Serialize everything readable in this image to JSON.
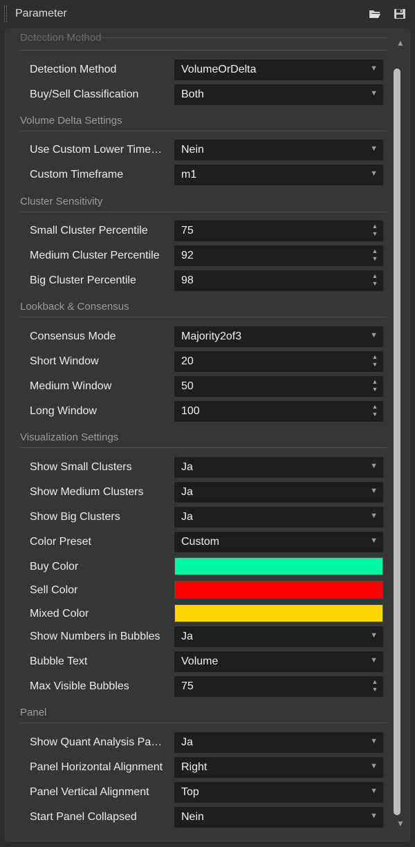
{
  "window": {
    "title": "Parameter"
  },
  "sections": {
    "detection": "Detection Method",
    "volume_delta": "Volume Delta Settings",
    "cluster": "Cluster Sensitivity",
    "lookback": "Lookback & Consensus",
    "visualization": "Visualization Settings",
    "panel": "Panel"
  },
  "rows": {
    "detection_method": {
      "label": "Detection Method",
      "value": "VolumeOrDelta"
    },
    "buy_sell_classification": {
      "label": "Buy/Sell Classification",
      "value": "Both"
    },
    "use_custom_lower_timeframe": {
      "label": "Use Custom Lower Time…",
      "value": "Nein"
    },
    "custom_timeframe": {
      "label": "Custom Timeframe",
      "value": "m1"
    },
    "small_cluster_percentile": {
      "label": "Small Cluster Percentile",
      "value": "75"
    },
    "medium_cluster_percentile": {
      "label": "Medium Cluster Percentile",
      "value": "92"
    },
    "big_cluster_percentile": {
      "label": "Big Cluster Percentile",
      "value": "98"
    },
    "consensus_mode": {
      "label": "Consensus Mode",
      "value": "Majority2of3"
    },
    "short_window": {
      "label": "Short Window",
      "value": "20"
    },
    "medium_window": {
      "label": "Medium Window",
      "value": "50"
    },
    "long_window": {
      "label": "Long Window",
      "value": "100"
    },
    "show_small_clusters": {
      "label": "Show Small Clusters",
      "value": "Ja"
    },
    "show_medium_clusters": {
      "label": "Show Medium Clusters",
      "value": "Ja"
    },
    "show_big_clusters": {
      "label": "Show Big Clusters",
      "value": "Ja"
    },
    "color_preset": {
      "label": "Color Preset",
      "value": "Custom"
    },
    "buy_color": {
      "label": "Buy Color",
      "color": "#00f5a4"
    },
    "sell_color": {
      "label": "Sell Color",
      "color": "#ff0000"
    },
    "mixed_color": {
      "label": "Mixed Color",
      "color": "#ffd700"
    },
    "show_numbers_in_bubbles": {
      "label": "Show Numbers in Bubbles",
      "value": "Ja"
    },
    "bubble_text": {
      "label": "Bubble Text",
      "value": "Volume"
    },
    "max_visible_bubbles": {
      "label": "Max Visible Bubbles",
      "value": "75"
    },
    "show_quant_analysis_panel": {
      "label": "Show Quant Analysis Pa…",
      "value": "Ja"
    },
    "panel_horizontal_alignment": {
      "label": "Panel Horizontal Alignment",
      "value": "Right"
    },
    "panel_vertical_alignment": {
      "label": "Panel Vertical Alignment",
      "value": "Top"
    },
    "start_panel_collapsed": {
      "label": "Start Panel Collapsed",
      "value": "Nein"
    }
  },
  "glyphs": {
    "dropdown": "▼",
    "spin_up": "▲",
    "spin_down": "▼",
    "scroll_up": "▲",
    "scroll_down": "▼"
  },
  "icons": {
    "open": "folder-open-icon",
    "save": "save-icon"
  },
  "colors": {
    "background": "#2d2d2d",
    "panel": "#363636",
    "field": "#1e1e1e",
    "section_text": "#9b9b9b"
  }
}
